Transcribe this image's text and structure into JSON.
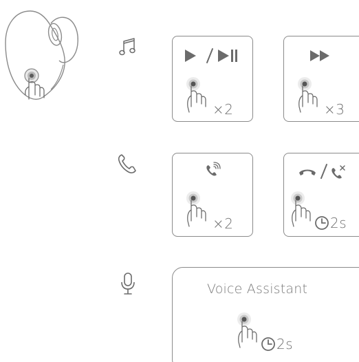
{
  "controls": {
    "music": {
      "icon": "music-note-icon",
      "play_pause": {
        "icon": "play-pause-icon",
        "gesture": "tap-gesture-icon",
        "count": "×2"
      },
      "next_track": {
        "icon": "fast-forward-icon",
        "gesture": "tap-gesture-icon",
        "count": "×3"
      }
    },
    "call": {
      "icon": "phone-icon",
      "answer": {
        "icon": "phone-ringing-icon",
        "gesture": "tap-gesture-icon",
        "count": "×2"
      },
      "hangup_reject": {
        "icon": "hangup-reject-icon",
        "gesture": "tap-gesture-icon",
        "hold": "2s"
      }
    },
    "voice": {
      "icon": "microphone-icon",
      "assistant": {
        "label": "Voice Assistant",
        "gesture": "tap-gesture-icon",
        "hold": "2s"
      }
    }
  },
  "colors": {
    "stroke": "#8a8a8a",
    "icon": "#6b6b6b"
  }
}
